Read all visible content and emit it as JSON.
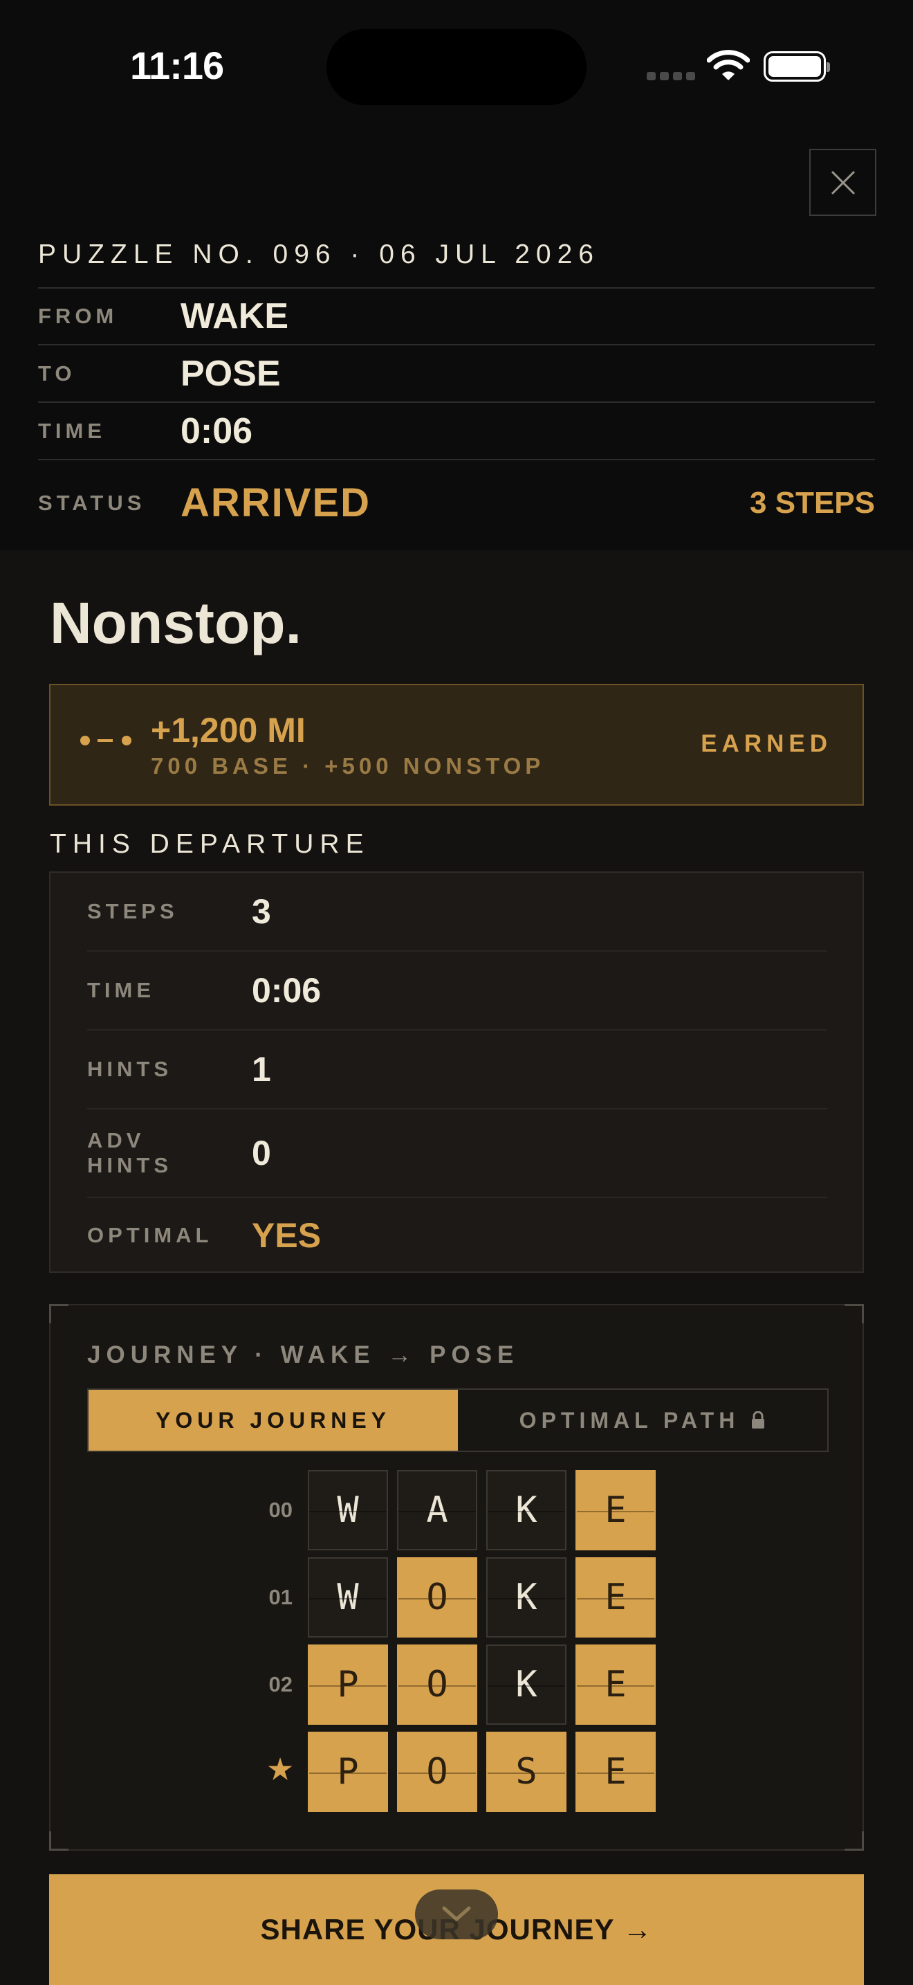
{
  "status_bar": {
    "time": "11:16"
  },
  "ticket": {
    "puzzle_title": "PUZZLE NO. 096 · 06 JUL 2026",
    "from_label": "FROM",
    "from_value": "WAKE",
    "to_label": "TO",
    "to_value": "POSE",
    "time_label": "TIME",
    "time_value": "0:06",
    "status_label": "STATUS",
    "status_value": "ARRIVED",
    "steps_value": "3 STEPS"
  },
  "headline": "Nonstop.",
  "earned": {
    "miles": "+1,200 MI",
    "detail": "700 BASE · +500 NONSTOP",
    "tag": "EARNED"
  },
  "departure": {
    "title": "THIS DEPARTURE",
    "rows": [
      {
        "label": "STEPS",
        "value": "3"
      },
      {
        "label": "TIME",
        "value": "0:06"
      },
      {
        "label": "HINTS",
        "value": "1"
      },
      {
        "label": "ADV HINTS",
        "value": "0"
      },
      {
        "label": "OPTIMAL",
        "value": "YES"
      }
    ]
  },
  "journey": {
    "title": "JOURNEY · WAKE → POSE",
    "tab_yours": "YOUR JOURNEY",
    "tab_optimal": "OPTIMAL PATH",
    "rows": [
      {
        "index": "00",
        "letters": [
          "W",
          "A",
          "K",
          "E"
        ],
        "highlight": [
          false,
          false,
          false,
          true
        ]
      },
      {
        "index": "01",
        "letters": [
          "W",
          "O",
          "K",
          "E"
        ],
        "highlight": [
          false,
          true,
          false,
          true
        ]
      },
      {
        "index": "02",
        "letters": [
          "P",
          "O",
          "K",
          "E"
        ],
        "highlight": [
          true,
          true,
          false,
          true
        ]
      },
      {
        "index": "★",
        "letters": [
          "P",
          "O",
          "S",
          "E"
        ],
        "highlight": [
          true,
          true,
          true,
          true
        ]
      }
    ]
  },
  "share_label": "SHARE YOUR JOURNEY →",
  "colors": {
    "accent": "#d7a24e",
    "background": "#141210",
    "header": "#0c0c0c"
  },
  "icons": [
    "close-icon",
    "route-icon",
    "lock-icon",
    "chevron-down-icon",
    "wifi-icon",
    "battery-icon",
    "cellular-icon"
  ]
}
